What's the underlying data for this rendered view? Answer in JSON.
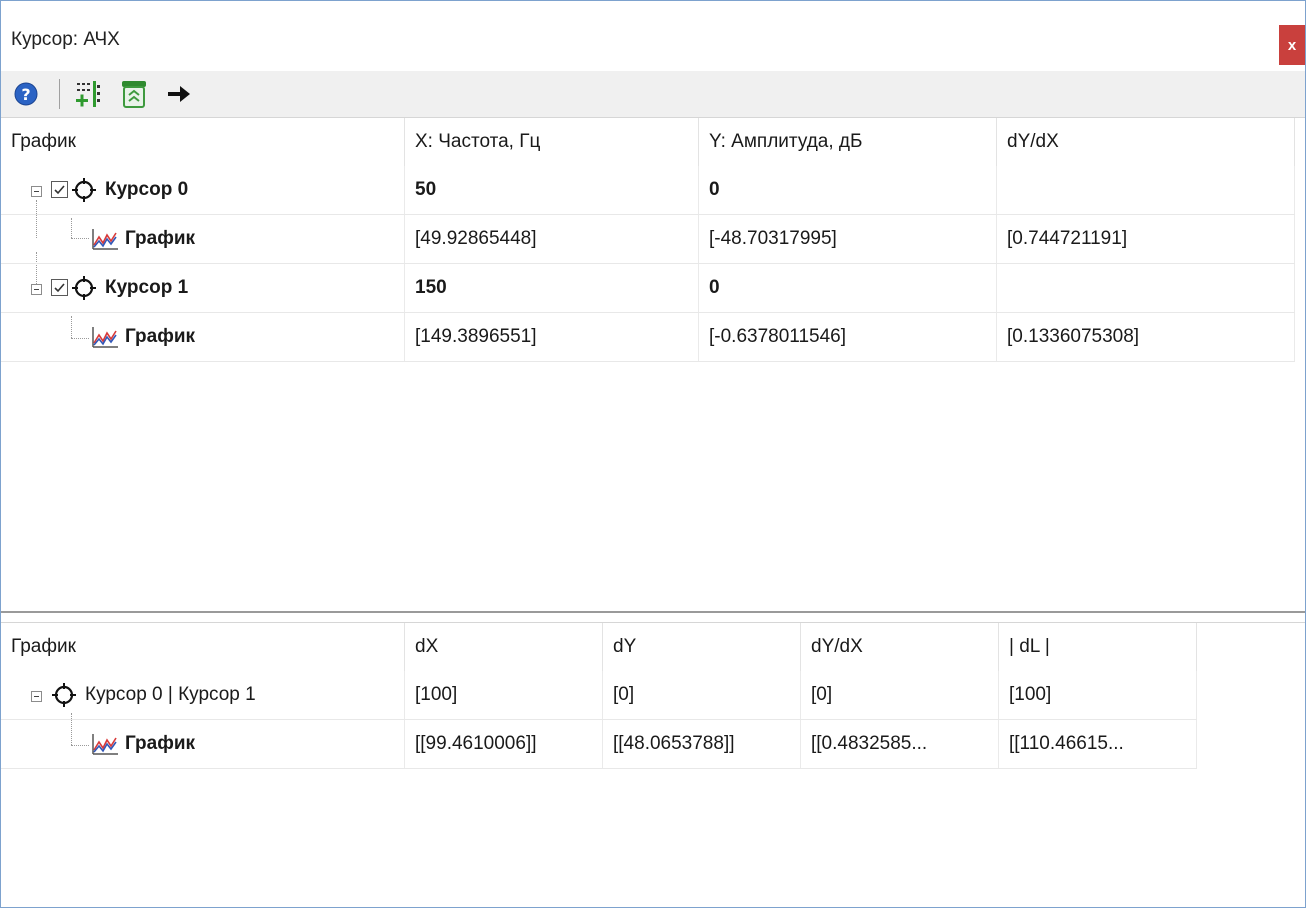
{
  "window": {
    "title": "Курсор: АЧХ",
    "close_label": "x"
  },
  "toolbar": {
    "icons": [
      "help-icon",
      "add-cursor-icon",
      "delete-cursor-icon",
      "arrow-right-icon"
    ]
  },
  "cursor_table": {
    "columns": [
      "График",
      "X: Частота, Гц",
      "Y: Амплитуда, дБ",
      "dY/dX"
    ],
    "rows": [
      {
        "label": "Курсор 0",
        "x": "50",
        "y": "0",
        "dydx": "",
        "checked": true
      },
      {
        "label": "График",
        "x": "[49.92865448]",
        "y": "[-48.70317995]",
        "dydx": "[0.744721191]"
      },
      {
        "label": "Курсор 1",
        "x": "150",
        "y": "0",
        "dydx": "",
        "checked": true
      },
      {
        "label": "График",
        "x": "[149.3896551]",
        "y": "[-0.6378011546]",
        "dydx": "[0.1336075308]"
      }
    ]
  },
  "delta_table": {
    "columns": [
      "График",
      "dX",
      "dY",
      "dY/dX",
      "| dL |"
    ],
    "rows": [
      {
        "label": "Курсор 0 | Курсор 1",
        "dx": "[100]",
        "dy": "[0]",
        "dydx": "[0]",
        "dl": "[100]"
      },
      {
        "label": "График",
        "dx": "[[99.4610006]]",
        "dy": "[[48.0653788]]",
        "dydx": "[[0.4832585...",
        "dl": "[[110.46615..."
      }
    ]
  },
  "colors": {
    "close_button": "#c9403d",
    "window_border": "#7da2ce",
    "help_icon": "#2b63c4",
    "add_icon": "#2f9a2f",
    "trash_icon": "#3e9a3e",
    "graph_icon_red": "#d83a3a",
    "graph_icon_blue": "#3157b8"
  }
}
